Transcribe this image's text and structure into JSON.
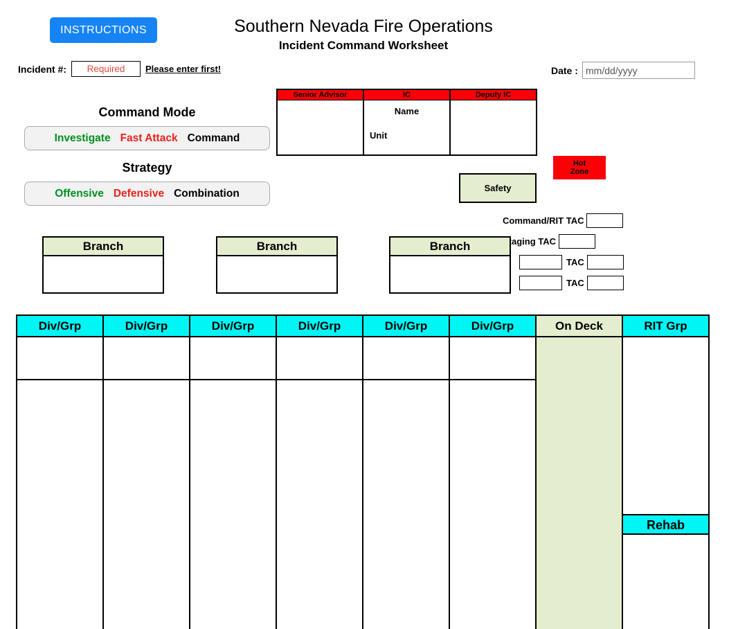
{
  "header": {
    "instructions_label": "INSTRUCTIONS",
    "title_main": "Southern Nevada Fire Operations",
    "title_sub": "Incident Command Worksheet",
    "incident_label": "Incident #:",
    "incident_value": "",
    "incident_placeholder": "Required",
    "incident_note": "Please enter first!",
    "date_label": "Date :",
    "date_value": "",
    "date_placeholder": "mm/dd/yyyy"
  },
  "command_mode": {
    "heading": "Command Mode",
    "options": [
      {
        "label": "Investigate",
        "color": "#008f1f"
      },
      {
        "label": "Fast Attack",
        "color": "#e8221c"
      },
      {
        "label": "Command",
        "color": "#000000"
      }
    ]
  },
  "strategy": {
    "heading": "Strategy",
    "options": [
      {
        "label": "Offensive",
        "color": "#008f1f"
      },
      {
        "label": "Defensive",
        "color": "#e8221c"
      },
      {
        "label": "Combination",
        "color": "#000000"
      }
    ]
  },
  "ic_table": {
    "columns": [
      {
        "header": "Senior Advisor",
        "name_label": "",
        "unit_label": ""
      },
      {
        "header": "IC",
        "name_label": "Name",
        "unit_label": "Unit"
      },
      {
        "header": "Deputy IC",
        "name_label": "",
        "unit_label": ""
      }
    ]
  },
  "safety": {
    "label": "Safety"
  },
  "hot_zone": {
    "line1": "Hot",
    "line2": "Zone"
  },
  "tac": {
    "rows": [
      {
        "label": "Command/RIT TAC",
        "prefix_value": null,
        "value": ""
      },
      {
        "label": "Staging TAC",
        "prefix_value": null,
        "value": ""
      },
      {
        "label": "TAC",
        "prefix_value": "",
        "value": ""
      },
      {
        "label": "TAC",
        "prefix_value": "",
        "value": ""
      }
    ]
  },
  "branches": [
    {
      "header": "Branch",
      "value": ""
    },
    {
      "header": "Branch",
      "value": ""
    },
    {
      "header": "Branch",
      "value": ""
    }
  ],
  "main_grid": {
    "columns": [
      {
        "header": "Div/Grp",
        "style": "cyan",
        "value_top": "",
        "value_rest": ""
      },
      {
        "header": "Div/Grp",
        "style": "cyan",
        "value_top": "",
        "value_rest": ""
      },
      {
        "header": "Div/Grp",
        "style": "cyan",
        "value_top": "",
        "value_rest": ""
      },
      {
        "header": "Div/Grp",
        "style": "cyan",
        "value_top": "",
        "value_rest": ""
      },
      {
        "header": "Div/Grp",
        "style": "cyan",
        "value_top": "",
        "value_rest": ""
      },
      {
        "header": "Div/Grp",
        "style": "cyan",
        "value_top": "",
        "value_rest": ""
      }
    ],
    "on_deck": {
      "header": "On Deck",
      "style": "sage",
      "value": ""
    },
    "rit": {
      "header": "RIT Grp",
      "style": "cyan",
      "value": ""
    },
    "rehab": {
      "header": "Rehab",
      "style": "cyan",
      "value": ""
    }
  },
  "colors": {
    "cyan": "#00f5f5",
    "sage": "#e4edce",
    "red": "#fb0007",
    "blue_button": "#1683f5",
    "green_text": "#008f1f",
    "red_text": "#e8221c",
    "placeholder_red": "#e04a3a"
  }
}
